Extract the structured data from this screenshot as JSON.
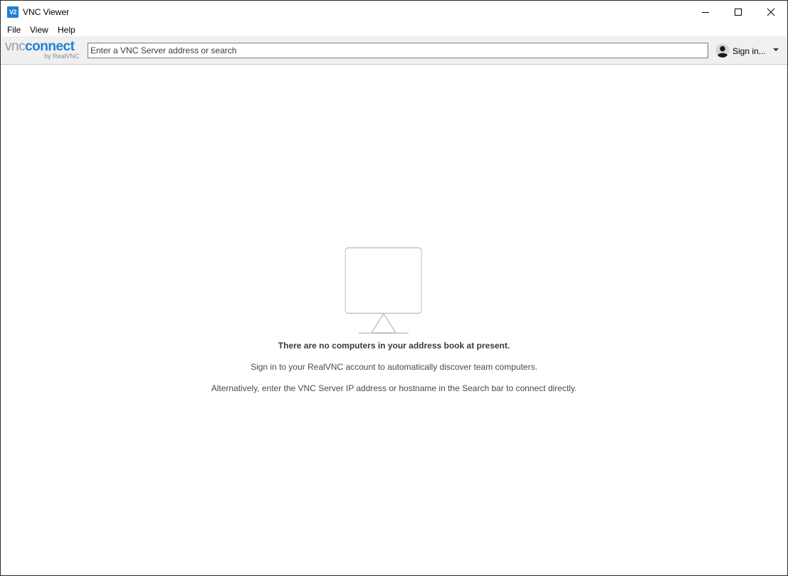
{
  "window": {
    "app_icon_text": "V2",
    "title": "VNC Viewer",
    "controls": {
      "minimize": "minimize-icon",
      "maximize": "maximize-icon",
      "close": "close-icon"
    }
  },
  "menu": {
    "items": [
      {
        "label": "File"
      },
      {
        "label": "View"
      },
      {
        "label": "Help"
      }
    ]
  },
  "toolbar": {
    "logo": {
      "word_vnc": "vnc",
      "word_connect": "connect",
      "byline": "by RealVNC"
    },
    "search": {
      "value": "",
      "placeholder": "Enter a VNC Server address or search"
    },
    "signin": {
      "label": "Sign in...",
      "icon": "user-icon",
      "dropdown_icon": "caret-down-icon"
    }
  },
  "main": {
    "empty_state": {
      "icon": "monitor-icon",
      "heading": "There are no computers in your address book at present.",
      "line1": "Sign in to your RealVNC account to automatically discover team computers.",
      "line2": "Alternatively, enter the VNC Server IP address or hostname in the Search bar to connect directly."
    }
  },
  "colors": {
    "accent": "#1f7fd6",
    "toolbar_bg": "#f0f0f0",
    "muted_text": "#4a4a4a",
    "illustration_stroke": "#b8b8b8"
  }
}
